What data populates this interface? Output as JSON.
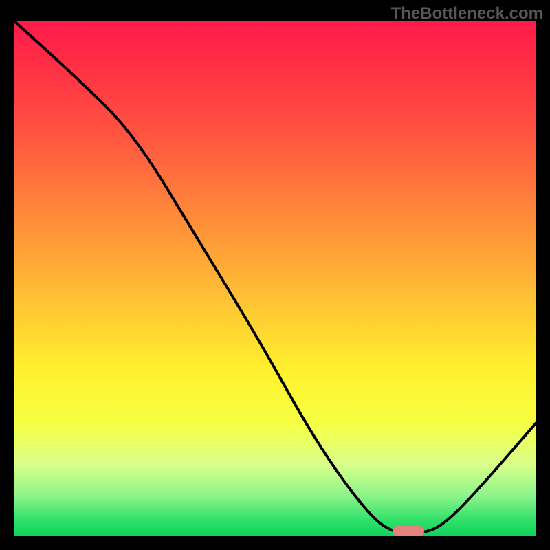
{
  "watermark": "TheBottleneck.com",
  "colors": {
    "curve_stroke": "#000000",
    "marker_fill": "#e4837e",
    "frame_bg": "#000000"
  },
  "chart_data": {
    "type": "line",
    "title": "",
    "xlabel": "",
    "ylabel": "",
    "xlim": [
      0,
      100
    ],
    "ylim": [
      0,
      100
    ],
    "series": [
      {
        "name": "curve",
        "x": [
          0,
          12,
          23,
          35,
          47,
          58,
          68,
          73,
          78,
          82,
          88,
          100
        ],
        "y": [
          100,
          89,
          78,
          58,
          38,
          18,
          4,
          0.5,
          0.5,
          2,
          8,
          22
        ]
      }
    ],
    "marker": {
      "x_center": 75.5,
      "y_center": 1.0,
      "width": 6,
      "height": 2
    }
  }
}
